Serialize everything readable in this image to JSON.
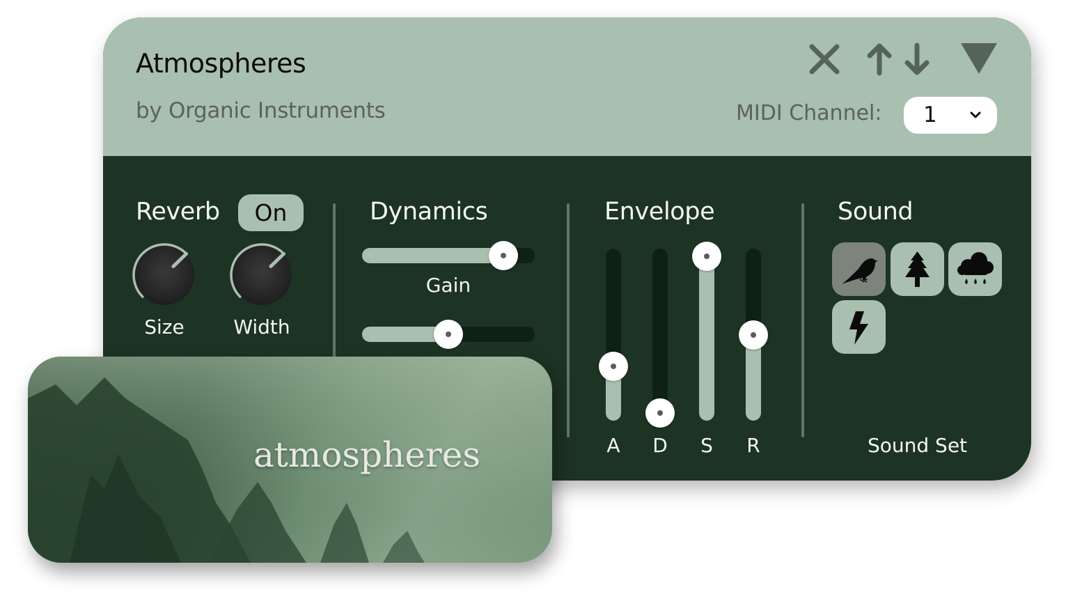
{
  "header": {
    "title": "Atmospheres",
    "subtitle": "by Organic Instruments",
    "icons": [
      "close-icon",
      "arrow-up-icon",
      "arrow-down-icon",
      "collapse-triangle-icon"
    ],
    "midi_label": "MIDI Channel:",
    "midi_value": "1"
  },
  "reverb": {
    "title": "Reverb",
    "toggle_label": "On",
    "knobs": [
      {
        "label": "Size",
        "value": 0.67
      },
      {
        "label": "Width",
        "value": 0.67
      }
    ]
  },
  "dynamics": {
    "title": "Dynamics",
    "sliders": [
      {
        "label": "Gain",
        "value": 0.85
      },
      {
        "label": "",
        "value": 0.5
      }
    ]
  },
  "envelope": {
    "title": "Envelope",
    "sliders": [
      {
        "label": "A",
        "value": 0.3
      },
      {
        "label": "D",
        "value": 0.0
      },
      {
        "label": "S",
        "value": 1.0
      },
      {
        "label": "R",
        "value": 0.5
      }
    ]
  },
  "sound": {
    "title": "Sound",
    "footer_label": "Sound Set",
    "buttons": [
      {
        "icon": "bird-icon",
        "selected": true
      },
      {
        "icon": "tree-icon",
        "selected": false
      },
      {
        "icon": "rain-cloud-icon",
        "selected": false
      },
      {
        "icon": "lightning-icon",
        "selected": false
      }
    ]
  },
  "card": {
    "title": "atmospheres"
  },
  "colors": {
    "header_bg": "#a9bfb0",
    "body_bg": "#1d3324",
    "accent": "#a9bfb0",
    "track_dark": "#0f2015",
    "selected_button": "#7c847c"
  }
}
